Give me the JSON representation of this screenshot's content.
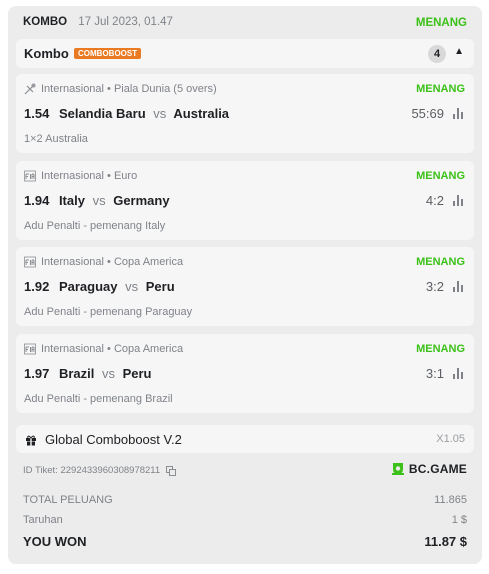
{
  "header": {
    "bet_type": "KOMBO",
    "date": "17 Jul 2023, 01.47",
    "status": "MENANG"
  },
  "kombo": {
    "title": "Kombo",
    "badge": "COMBOBOOST",
    "count": "4",
    "caret": "▲"
  },
  "legs": [
    {
      "sport_icon": "tennis-shuttle-icon",
      "category": "Internasional",
      "tournament": "Piala Dunia (5 overs)",
      "status": "MENANG",
      "odds": "1.54",
      "home": "Selandia Baru",
      "vs": "vs",
      "away": "Australia",
      "score": "55:69",
      "market": "1×2 Australia"
    },
    {
      "sport_icon": "fifa-icon",
      "category": "Internasional",
      "tournament": "Euro",
      "status": "MENANG",
      "odds": "1.94",
      "home": "Italy",
      "vs": "vs",
      "away": "Germany",
      "score": "4:2",
      "market": "Adu Penalti - pemenang Italy"
    },
    {
      "sport_icon": "fifa-icon",
      "category": "Internasional",
      "tournament": "Copa America",
      "status": "MENANG",
      "odds": "1.92",
      "home": "Paraguay",
      "vs": "vs",
      "away": "Peru",
      "score": "3:2",
      "market": "Adu Penalti - pemenang Paraguay"
    },
    {
      "sport_icon": "fifa-icon",
      "category": "Internasional",
      "tournament": "Copa America",
      "status": "MENANG",
      "odds": "1.97",
      "home": "Brazil",
      "vs": "vs",
      "away": "Peru",
      "score": "3:1",
      "market": "Adu Penalti - pemenang Brazil"
    }
  ],
  "global_boost": {
    "label": "Global Comboboost V.2",
    "multiplier": "X1.05"
  },
  "ticket": {
    "label": "ID Tiket:",
    "id": "2292433960308978211"
  },
  "brand": {
    "name": "BC.GAME"
  },
  "summary": {
    "total_odds_label": "TOTAL PELUANG",
    "total_odds_value": "11.865",
    "stake_label": "Taruhan",
    "stake_value": "1 $",
    "won_label": "YOU WON",
    "won_value": "11.87 $"
  },
  "colors": {
    "win_green": "#3bc117",
    "boost_orange": "#ea7a21",
    "card_bg": "#ececec",
    "panel_bg": "#f6f6f6"
  }
}
